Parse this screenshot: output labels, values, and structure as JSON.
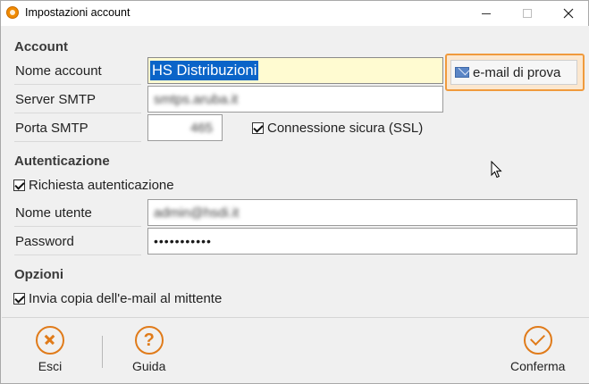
{
  "window": {
    "title": "Impostazioni account"
  },
  "sections": {
    "account": "Account",
    "authentication": "Autenticazione",
    "options": "Opzioni"
  },
  "fields": {
    "account_name": {
      "label": "Nome account",
      "value": "HS Distribuzioni"
    },
    "smtp_server": {
      "label": "Server SMTP",
      "value": "smtps.aruba.it"
    },
    "smtp_port": {
      "label": "Porta SMTP",
      "value": "465"
    },
    "username": {
      "label": "Nome utente",
      "value": "admin@hsdi.it"
    },
    "password": {
      "label": "Password",
      "value": "•••••••••••"
    }
  },
  "checks": {
    "ssl": {
      "label": "Connessione sicura (SSL)",
      "checked": true
    },
    "auth_required": {
      "label": "Richiesta autenticazione",
      "checked": true
    },
    "send_copy": {
      "label": "Invia copia dell'e-mail al mittente",
      "checked": true
    }
  },
  "buttons": {
    "test_email": "e-mail di prova",
    "exit": "Esci",
    "help": "Guida",
    "confirm": "Conferma"
  },
  "icons": {
    "app": "app-logo-icon",
    "mail": "envelope-icon",
    "exit": "x-circle-icon",
    "help": "question-circle-icon",
    "confirm": "check-circle-icon"
  },
  "colors": {
    "accent": "#e07b1a",
    "selection": "#0a64c8",
    "highlight_field": "#fffbd1"
  }
}
